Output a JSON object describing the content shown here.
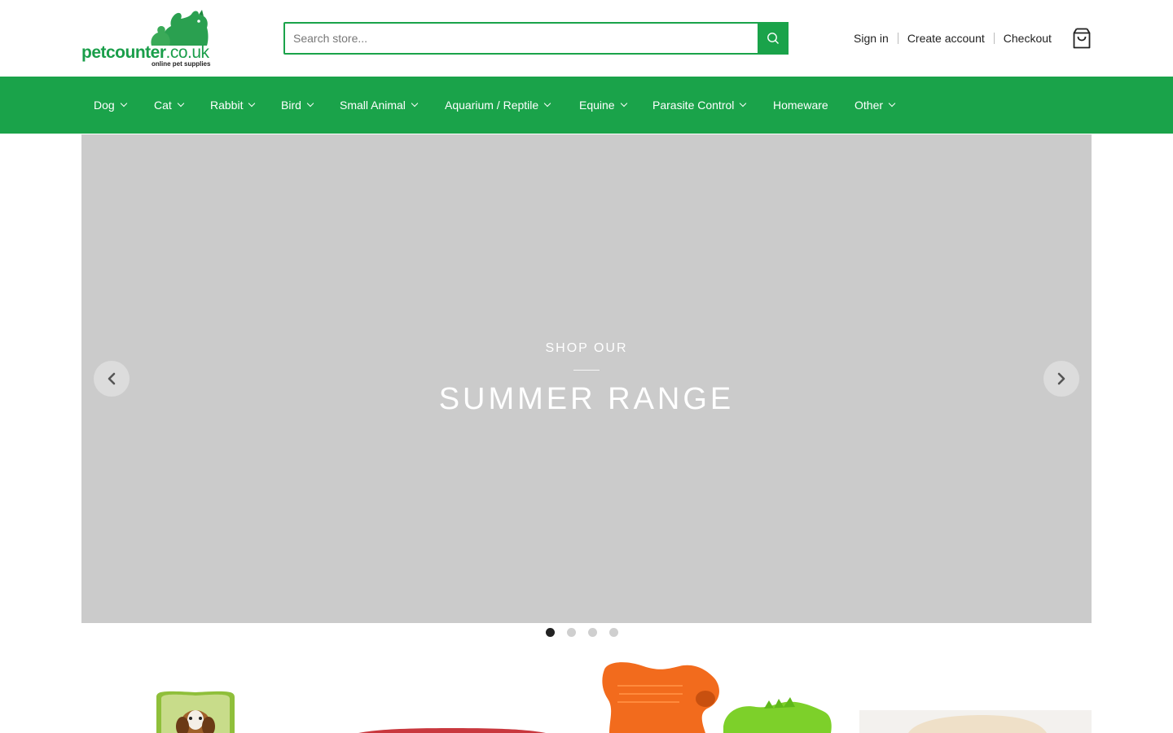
{
  "brand": {
    "name": "petcounter",
    "domain_suffix": ".co.uk",
    "tagline": "online pet supplies",
    "color": "#1aa34a"
  },
  "search": {
    "placeholder": "Search store..."
  },
  "account": {
    "sign_in": "Sign in",
    "create_account": "Create account",
    "checkout": "Checkout"
  },
  "icons": {
    "search": "search-icon",
    "cart": "shopping-bag-icon",
    "prev": "chevron-left-icon",
    "next": "chevron-right-icon"
  },
  "nav": {
    "items": [
      {
        "label": "Dog",
        "has_dropdown": true
      },
      {
        "label": "Cat",
        "has_dropdown": true
      },
      {
        "label": "Rabbit",
        "has_dropdown": true
      },
      {
        "label": "Bird",
        "has_dropdown": true
      },
      {
        "label": "Small Animal",
        "has_dropdown": true
      },
      {
        "label": "Aquarium / Reptile",
        "has_dropdown": true
      },
      {
        "label": "Equine",
        "has_dropdown": true
      },
      {
        "label": "Parasite Control",
        "has_dropdown": true
      },
      {
        "label": "Homeware",
        "has_dropdown": false
      },
      {
        "label": "Other",
        "has_dropdown": true
      }
    ]
  },
  "hero": {
    "kicker": "SHOP OUR",
    "title": "SUMMER RANGE",
    "slide_count": 4,
    "active_slide": 1,
    "background": "#cbcbcb"
  },
  "products": {
    "items": [
      "dog-treat-tube",
      "red-pet-bed",
      "orange-green-dog-toys",
      "cream-pet-bed"
    ]
  }
}
